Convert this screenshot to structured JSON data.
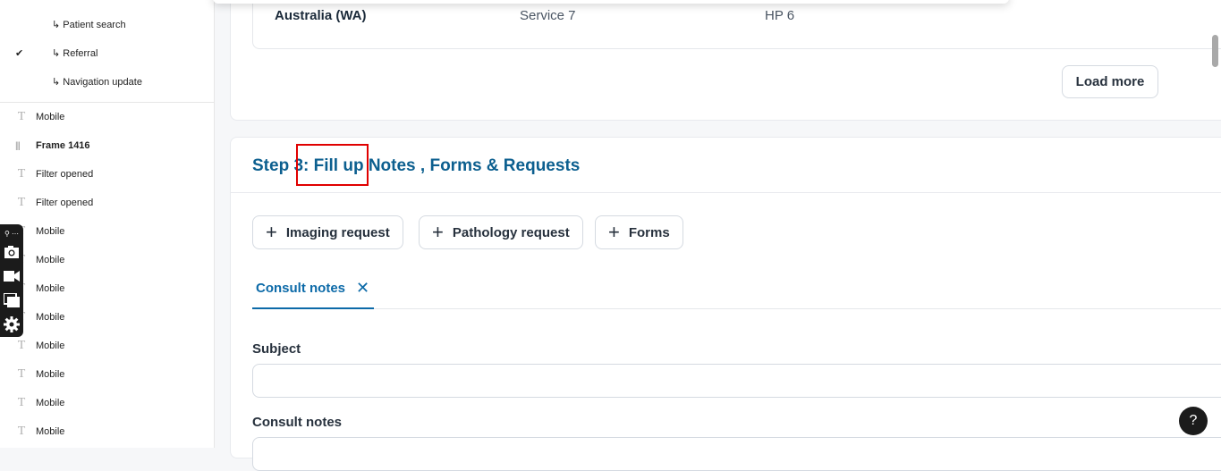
{
  "layers_panel": {
    "sub_items": [
      {
        "label": "↳ Patient search",
        "checked": false
      },
      {
        "label": "↳ Referral",
        "checked": true
      },
      {
        "label": "↳ Navigation update",
        "checked": false
      }
    ],
    "check_glyph": "✔",
    "items": [
      {
        "label": "Mobile",
        "icon": "text-icon"
      },
      {
        "label": "Frame 1416",
        "icon": "frame-icon",
        "bold": true
      },
      {
        "label": "Filter opened",
        "icon": "text-icon"
      },
      {
        "label": "Filter opened",
        "icon": "text-icon"
      },
      {
        "label": "Mobile",
        "icon": "text-icon"
      },
      {
        "label": "Mobile",
        "icon": "text-icon"
      },
      {
        "label": "Mobile",
        "icon": "text-icon"
      },
      {
        "label": "Mobile",
        "icon": "text-icon"
      },
      {
        "label": "Mobile",
        "icon": "text-icon"
      },
      {
        "label": "Mobile",
        "icon": "text-icon"
      },
      {
        "label": "Mobile",
        "icon": "text-icon"
      },
      {
        "label": "Mobile",
        "icon": "text-icon"
      }
    ],
    "text_icon_glyph": "T",
    "frame_icon_glyph": "|||"
  },
  "floating_toolbar": {
    "top_glyph": "⚲ ⋯",
    "buttons": [
      "camera-icon",
      "video-icon",
      "windows-icon",
      "settings-icon"
    ]
  },
  "results_table": {
    "row": [
      "Australia (WA)",
      "Service 7",
      "HP 6"
    ],
    "load_more_label": "Load more"
  },
  "step": {
    "title": "Step 3: Fill up Notes , Forms & Requests",
    "request_buttons": [
      {
        "label": "Imaging request"
      },
      {
        "label": "Pathology request"
      },
      {
        "label": "Forms"
      }
    ],
    "plus_glyph": "+",
    "tabs": [
      {
        "label": "Consult notes",
        "active": true,
        "close_glyph": "✕"
      }
    ],
    "fields": [
      {
        "label": "Subject",
        "value": "",
        "placeholder": ""
      },
      {
        "label": "Consult notes",
        "value": "",
        "placeholder": ""
      }
    ]
  },
  "help": {
    "glyph": "?"
  },
  "colors": {
    "accent": "#0c5f8f",
    "tab_accent": "#0c6aa8",
    "highlight": "#e00000"
  }
}
